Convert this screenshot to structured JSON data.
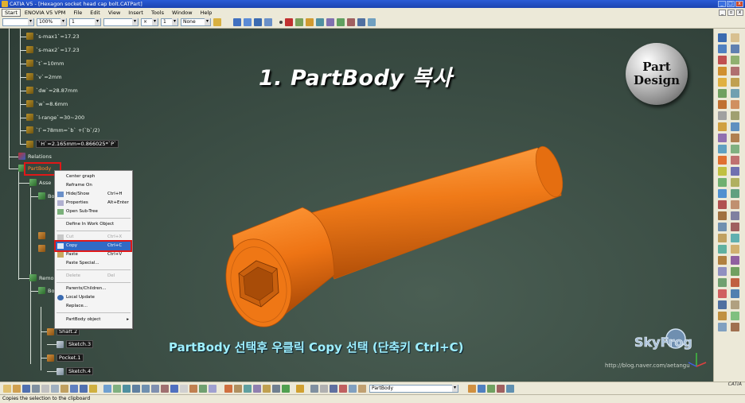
{
  "window": {
    "title": "CATIA V5 - [Hexagon socket head cap bolt.CATPart]",
    "buttons": [
      "_",
      "□",
      "x"
    ]
  },
  "menu": {
    "items": [
      "Start",
      "ENOVIA V5 VPM",
      "File",
      "Edit",
      "View",
      "Insert",
      "Tools",
      "Window",
      "Help"
    ]
  },
  "toolbar_top": {
    "zoom_value": "100%",
    "line_value": "1",
    "point_value": "1",
    "layer_value": "None"
  },
  "tree": {
    "params": [
      "`s-max1`=17.23",
      "`s-max2`=17.23",
      "`t`=10mm",
      "`v`=2mm",
      "`dw`=28.87mm",
      "`w`=8.6mm",
      "`l-range`=30~200",
      "`l`=78mm=`b` +(`b`/2)",
      "`H`=2.165mm=0.866025*`P`"
    ],
    "relations": "Relations",
    "partbody": "PartBody",
    "assemble": "Asse",
    "body1": "Bo",
    "remove": "Remo",
    "body2": "Bo",
    "shaft": "Shaft.2",
    "sketch3": "Sketch.3",
    "pocket": "Pocket.1",
    "sketch4": "Sketch.4"
  },
  "context_menu": {
    "items": [
      {
        "label": "Center graph",
        "shortcut": "",
        "disabled": false
      },
      {
        "label": "Reframe On",
        "shortcut": "",
        "disabled": false
      },
      {
        "label": "Hide/Show",
        "shortcut": "Ctrl+H",
        "disabled": false
      },
      {
        "label": "Properties",
        "shortcut": "Alt+Enter",
        "disabled": false
      },
      {
        "label": "Open Sub-Tree",
        "shortcut": "",
        "disabled": false
      },
      {
        "label": "Define In Work Object",
        "shortcut": "",
        "disabled": false
      },
      {
        "label": "Cut",
        "shortcut": "Ctrl+X",
        "disabled": true
      },
      {
        "label": "Copy",
        "shortcut": "Ctrl+C",
        "disabled": false
      },
      {
        "label": "Paste",
        "shortcut": "Ctrl+V",
        "disabled": false
      },
      {
        "label": "Paste Special...",
        "shortcut": "",
        "disabled": false
      },
      {
        "label": "Delete",
        "shortcut": "Del",
        "disabled": true
      },
      {
        "label": "Parents/Children...",
        "shortcut": "",
        "disabled": false
      },
      {
        "label": "Local Update",
        "shortcut": "",
        "disabled": false
      },
      {
        "label": "Replace...",
        "shortcut": "",
        "disabled": false
      },
      {
        "label": "PartBody object",
        "shortcut": "",
        "disabled": false
      }
    ]
  },
  "overlay": {
    "heading": "1. PartBody 복사",
    "caption": "PartBody 선택후 우클릭 Copy 선택 (단축키 Ctrl+C)",
    "badge_line1": "Part",
    "badge_line2": "Design",
    "watermark": "http://blog.naver.com/aetangu",
    "skyfrog": "SkyFrog"
  },
  "toolbar_bottom": {
    "body_select": "PartBody"
  },
  "status": {
    "text": "Copies the selection to the clipboard"
  },
  "logo": "CATIA",
  "colors": {
    "viewport_bg": "#3d4f46",
    "bolt_orange": "#f07a18",
    "caption_cyan": "#9ff0ff",
    "highlight_blue": "#316ac5",
    "red_box": "#e01818"
  }
}
